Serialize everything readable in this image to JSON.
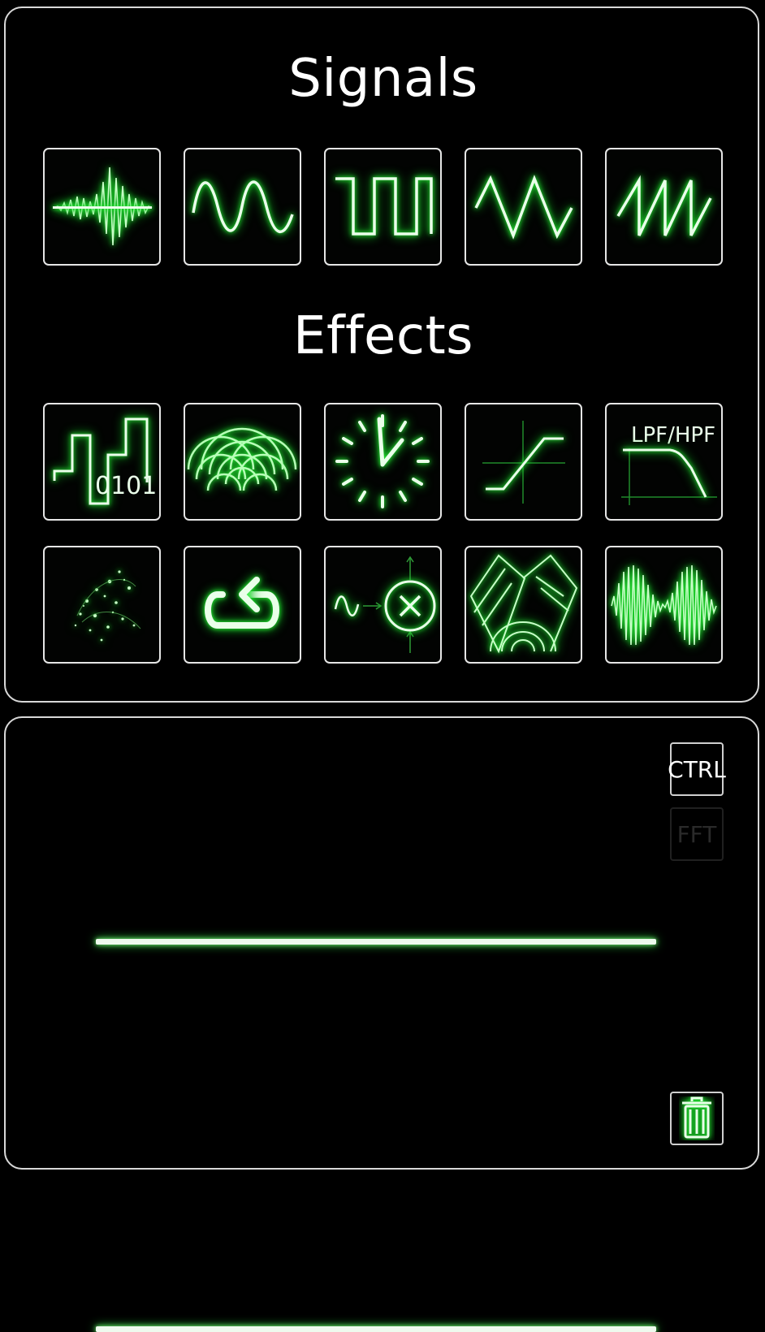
{
  "signals": {
    "title": "Signals",
    "items": [
      {
        "name": "noise-waveform-icon"
      },
      {
        "name": "sine-wave-icon"
      },
      {
        "name": "square-wave-icon"
      },
      {
        "name": "triangle-wave-icon"
      },
      {
        "name": "sawtooth-wave-icon"
      }
    ]
  },
  "effects": {
    "title": "Effects",
    "items": [
      {
        "name": "bitcrusher-icon",
        "label": "0101"
      },
      {
        "name": "chorus-ripple-icon"
      },
      {
        "name": "delay-clock-icon"
      },
      {
        "name": "distortion-curve-icon"
      },
      {
        "name": "lpf-hpf-filter-icon",
        "label": "LPF/HPF"
      },
      {
        "name": "sparkle-particle-icon"
      },
      {
        "name": "loop-arrow-icon"
      },
      {
        "name": "ring-modulator-icon"
      },
      {
        "name": "reverb-reflection-icon"
      },
      {
        "name": "amplitude-modulation-icon"
      }
    ]
  },
  "controls": {
    "ctrl_label": "CTRL",
    "fft_label": "FFT",
    "trash_icon": "trash-icon"
  },
  "colors": {
    "accent_green": "#1eea2e",
    "border": "#d8d8d8",
    "background": "#000000"
  }
}
